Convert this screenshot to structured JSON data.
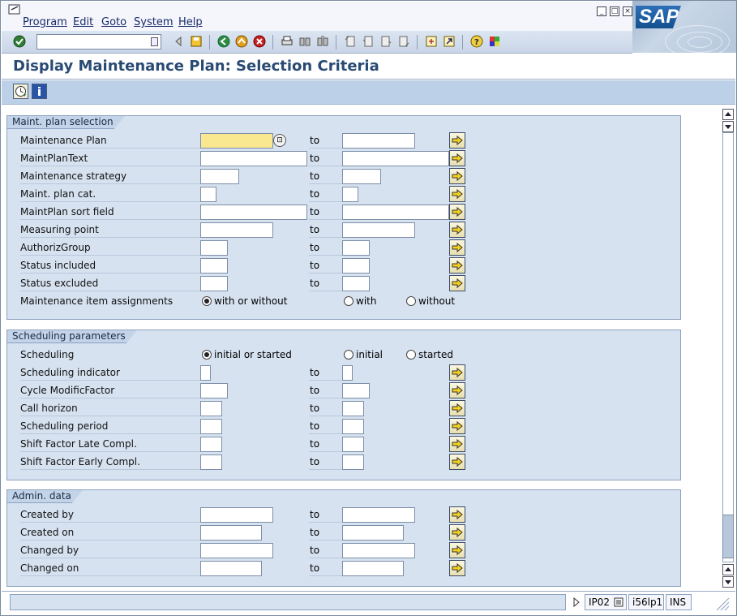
{
  "menu": {
    "items": [
      "Program",
      "Edit",
      "Goto",
      "System",
      "Help"
    ]
  },
  "logo": {
    "text": "SAP"
  },
  "toolbar": {
    "command_value": ""
  },
  "title": "Display Maintenance Plan: Selection Criteria",
  "to_label": "to",
  "groups": {
    "plan": {
      "title": "Maint. plan selection",
      "rows": [
        "Maintenance Plan",
        "MaintPlanText",
        "Maintenance strategy",
        "Maint. plan cat.",
        "MaintPlan sort field",
        "Measuring point",
        "AuthorizGroup",
        "Status included",
        "Status excluded",
        "Maintenance item assignments"
      ],
      "radios": [
        "with or without",
        "with",
        "without"
      ]
    },
    "sched": {
      "title": "Scheduling parameters",
      "rows": [
        "Scheduling",
        "Scheduling indicator",
        "Cycle ModificFactor",
        "Call horizon",
        "Scheduling period",
        "Shift Factor Late Compl.",
        "Shift Factor Early Compl."
      ],
      "radios": [
        "initial or started",
        "initial",
        "started"
      ]
    },
    "admin": {
      "title": "Admin. data",
      "rows": [
        "Created by",
        "Created on",
        "Changed by",
        "Changed on"
      ]
    }
  },
  "status": {
    "transaction": "IP02",
    "server": "i56lp1",
    "mode": "INS"
  },
  "colors": {
    "accent": "#284a73",
    "group_bg": "#d6e2f0",
    "focus_field": "#f9e890"
  }
}
